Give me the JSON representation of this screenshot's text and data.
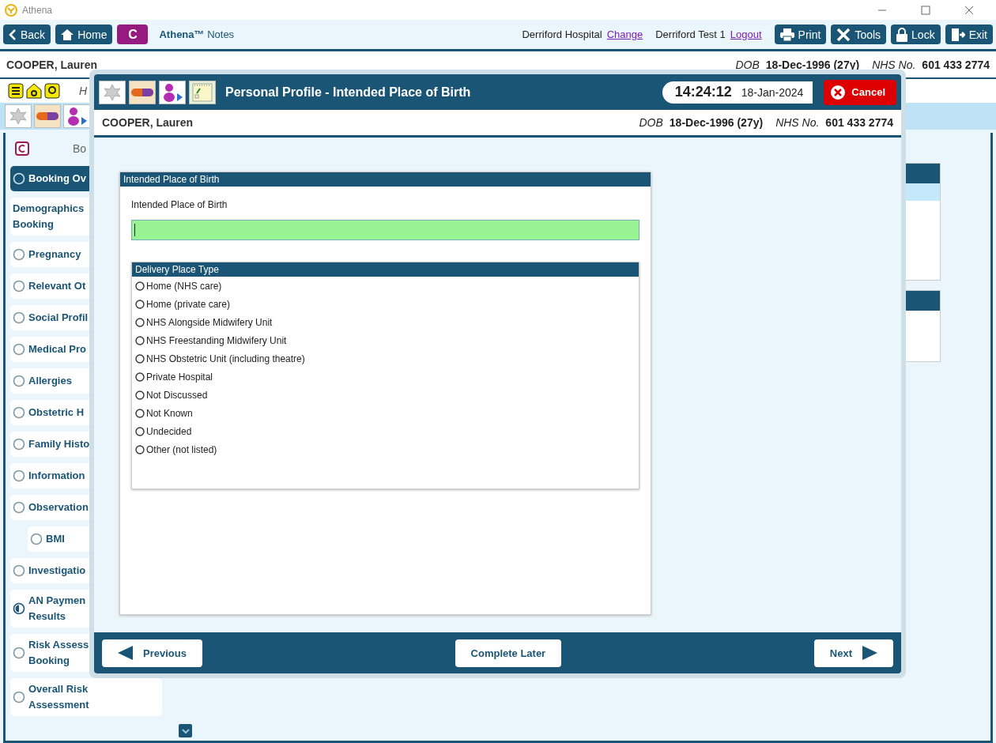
{
  "window": {
    "title": "Athena"
  },
  "toolbar": {
    "back": "Back",
    "home": "Home",
    "c_button": "C",
    "brand": "Athena™",
    "brand_suffix": "Notes",
    "hospital": "Derriford Hospital",
    "change_link": "Change",
    "user": "Derriford Test 1",
    "logout_link": "Logout",
    "buttons": [
      {
        "kind": "print",
        "label": "Print"
      },
      {
        "kind": "tools",
        "label": "Tools"
      },
      {
        "kind": "lock",
        "label": "Lock"
      },
      {
        "kind": "exit",
        "label": "Exit"
      }
    ]
  },
  "patient": {
    "name": "COOPER, Lauren",
    "dob_label": "DOB",
    "dob": "18-Dec-1996 (27y)",
    "nhs_label": "NHS No.",
    "nhs": "601 433 2774"
  },
  "help_row_text": "H",
  "sidebar": {
    "header": "Bo",
    "items": [
      {
        "label": "Booking Ov",
        "kind": "circle",
        "selected": true,
        "indent": false
      },
      {
        "label": "Demographics\nBooking",
        "kind": "plain",
        "selected": false,
        "indent": false
      },
      {
        "label": "Pregnancy",
        "kind": "circle",
        "selected": false,
        "indent": false
      },
      {
        "label": "Relevant Ot",
        "kind": "circle",
        "selected": false,
        "indent": false
      },
      {
        "label": "Social Profil",
        "kind": "circle",
        "selected": false,
        "indent": false
      },
      {
        "label": "Medical Pro",
        "kind": "circle",
        "selected": false,
        "indent": false
      },
      {
        "label": "Allergies",
        "kind": "circle",
        "selected": false,
        "indent": false
      },
      {
        "label": "Obstetric H",
        "kind": "circle",
        "selected": false,
        "indent": false
      },
      {
        "label": "Family Histo",
        "kind": "circle",
        "selected": false,
        "indent": false
      },
      {
        "label": "Information",
        "kind": "circle",
        "selected": false,
        "indent": false
      },
      {
        "label": "Observation",
        "kind": "circle",
        "selected": false,
        "indent": false
      },
      {
        "label": "BMI",
        "kind": "circle",
        "selected": false,
        "indent": true
      },
      {
        "label": "Investigatio",
        "kind": "circle",
        "selected": false,
        "indent": false
      },
      {
        "label": "AN Paymen\nResults",
        "kind": "halfcircle",
        "selected": false,
        "indent": false
      },
      {
        "label": "Risk Assess\nBooking",
        "kind": "circle",
        "selected": false,
        "indent": false
      },
      {
        "label": "Overall Risk\nAssessment",
        "kind": "circle",
        "selected": false,
        "indent": false
      }
    ]
  },
  "modal": {
    "title": "Personal Profile - Intended Place of Birth",
    "time": "14:24:12",
    "date": "18-Jan-2024",
    "cancel": "Cancel",
    "patient": {
      "name": "COOPER, Lauren",
      "dob_label": "DOB",
      "dob": "18-Dec-1996 (27y)",
      "nhs_label": "NHS No.",
      "nhs": "601 433 2774"
    },
    "section_title": "Intended Place of Birth",
    "field_label": "Intended Place of Birth",
    "group_title": "Delivery Place Type",
    "options": [
      {
        "label": "Home (NHS care)",
        "selected": false
      },
      {
        "label": "Home (private care)",
        "selected": false
      },
      {
        "label": "NHS Alongside Midwifery Unit",
        "selected": false
      },
      {
        "label": "NHS Freestanding Midwifery Unit",
        "selected": false
      },
      {
        "label": "NHS Obstetric Unit (including theatre)",
        "selected": false
      },
      {
        "label": "Private Hospital",
        "selected": false
      },
      {
        "label": "Not Discussed",
        "selected": false
      },
      {
        "label": "Not Known",
        "selected": false
      },
      {
        "label": "Undecided",
        "selected": false
      },
      {
        "label": "Other (not listed)",
        "selected": false
      }
    ],
    "previous": "Previous",
    "complete_later": "Complete Later",
    "next": "Next"
  }
}
